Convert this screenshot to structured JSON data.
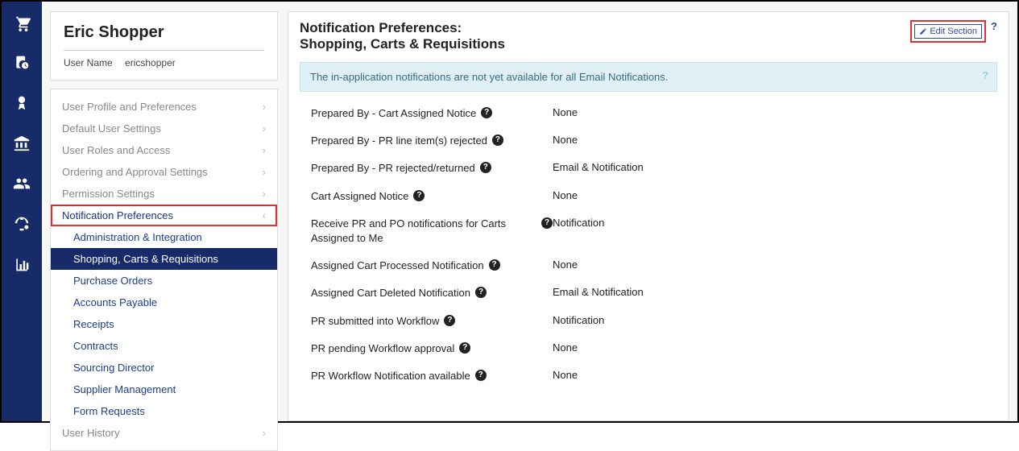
{
  "user": {
    "displayName": "Eric Shopper",
    "usernameLabel": "User Name",
    "username": "ericshopper"
  },
  "sidebar": {
    "sections": [
      {
        "label": "User Profile and Preferences",
        "expanded": false
      },
      {
        "label": "Default User Settings",
        "expanded": false
      },
      {
        "label": "User Roles and Access",
        "expanded": false
      },
      {
        "label": "Ordering and Approval Settings",
        "expanded": false
      },
      {
        "label": "Permission Settings",
        "expanded": false
      },
      {
        "label": "Notification Preferences",
        "expanded": true,
        "highlight": true
      },
      {
        "label": "User History",
        "expanded": false
      }
    ],
    "subitems": [
      {
        "label": "Administration & Integration",
        "active": false
      },
      {
        "label": "Shopping, Carts & Requisitions",
        "active": true
      },
      {
        "label": "Purchase Orders",
        "active": false
      },
      {
        "label": "Accounts Payable",
        "active": false
      },
      {
        "label": "Receipts",
        "active": false
      },
      {
        "label": "Contracts",
        "active": false
      },
      {
        "label": "Sourcing Director",
        "active": false
      },
      {
        "label": "Supplier Management",
        "active": false
      },
      {
        "label": "Form Requests",
        "active": false
      }
    ]
  },
  "header": {
    "titlePrefix": "Notification Preferences:",
    "titleSub": "Shopping, Carts & Requisitions",
    "editLabel": "Edit Section"
  },
  "banner": {
    "text": "The in-application notifications are not yet available for all Email Notifications."
  },
  "prefs": [
    {
      "label": "Prepared By - Cart Assigned Notice",
      "value": "None"
    },
    {
      "label": "Prepared By - PR line item(s) rejected",
      "value": "None"
    },
    {
      "label": "Prepared By - PR rejected/returned",
      "value": "Email & Notification"
    },
    {
      "label": "Cart Assigned Notice",
      "value": "None"
    },
    {
      "label": "Receive PR and PO notifications for Carts Assigned to Me",
      "value": "Notification"
    },
    {
      "label": "Assigned Cart Processed Notification",
      "value": "None"
    },
    {
      "label": "Assigned Cart Deleted Notification",
      "value": "Email & Notification"
    },
    {
      "label": "PR submitted into Workflow",
      "value": "Notification"
    },
    {
      "label": "PR pending Workflow approval",
      "value": "None"
    },
    {
      "label": "PR Workflow Notification available",
      "value": "None"
    }
  ]
}
